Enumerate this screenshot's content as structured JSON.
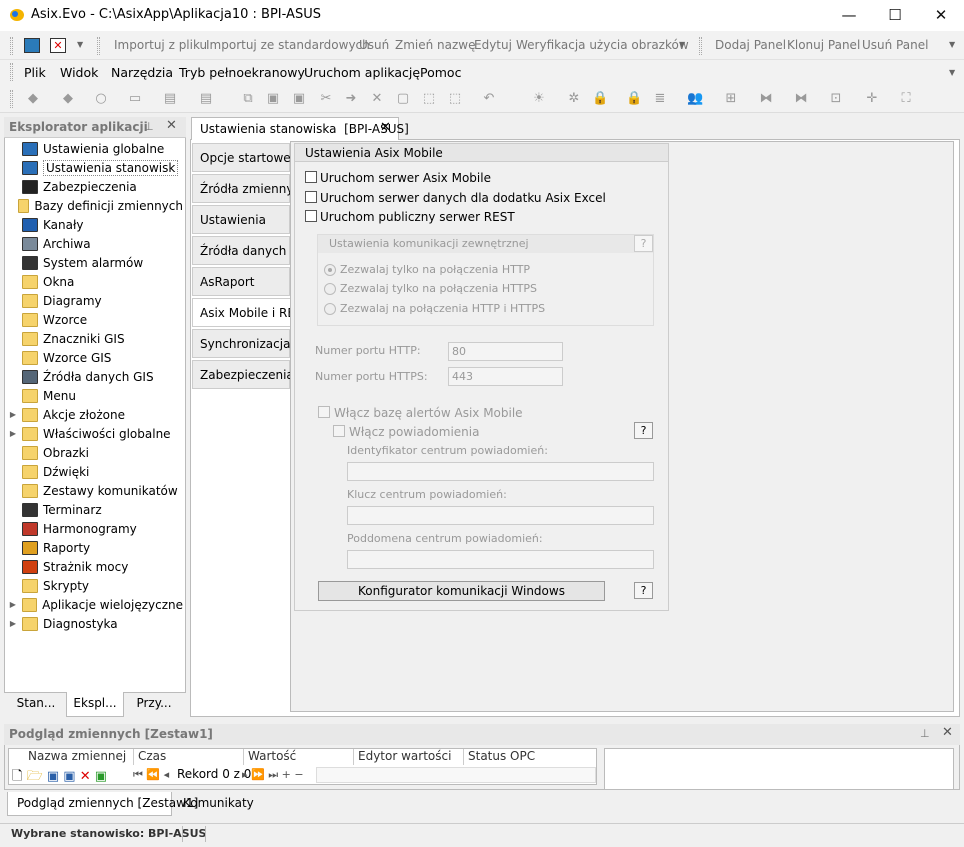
{
  "window": {
    "title": "Asix.Evo - C:\\AsixApp\\Aplikacja10 : BPI-ASUS",
    "min": "—",
    "max": "☐",
    "close": "✕"
  },
  "toolbar1": {
    "import_file": "Importuj z pliku",
    "import_std": "Importuj ze standardowych",
    "delete": "Usuń",
    "rename": "Zmień nazwę",
    "edit": "Edytuj",
    "verify": "Weryfikacja użycia obrazków",
    "add_panel": "Dodaj Panel",
    "clone_panel": "Klonuj Panel",
    "remove_panel": "Usuń Panel"
  },
  "menu": {
    "file": "Plik",
    "view": "Widok",
    "tools": "Narzędzia",
    "fullscreen": "Tryb pełnoekranowy",
    "run": "Uruchom aplikację",
    "help": "Pomoc"
  },
  "explorer": {
    "title": "Eksplorator aplikacji",
    "items": [
      {
        "label": "Ustawienia globalne",
        "icon": "globe-settings-icon",
        "color": "#2a6fb8",
        "expandable": false
      },
      {
        "label": "Ustawienia stanowisk",
        "icon": "workstation-settings-icon",
        "color": "#2a6fb8",
        "expandable": false
      },
      {
        "label": "Zabezpieczenia",
        "icon": "lock-icon",
        "color": "#222222",
        "expandable": false
      },
      {
        "label": "Bazy definicji zmiennych",
        "icon": "folder-icon",
        "color": "",
        "expandable": false
      },
      {
        "label": "Kanały",
        "icon": "globe-icon",
        "color": "#1f5fb0",
        "expandable": false
      },
      {
        "label": "Archiwa",
        "icon": "database-icon",
        "color": "#7a8a9a",
        "expandable": false
      },
      {
        "label": "System alarmów",
        "icon": "alarm-icon",
        "color": "#333333",
        "expandable": false
      },
      {
        "label": "Okna",
        "icon": "folder-icon",
        "color": "",
        "expandable": false
      },
      {
        "label": "Diagramy",
        "icon": "folder-icon",
        "color": "",
        "expandable": false
      },
      {
        "label": "Wzorce",
        "icon": "folder-icon",
        "color": "",
        "expandable": false
      },
      {
        "label": "Znaczniki GIS",
        "icon": "folder-icon",
        "color": "",
        "expandable": false
      },
      {
        "label": "Wzorce GIS",
        "icon": "folder-icon",
        "color": "",
        "expandable": false
      },
      {
        "label": "Źródła danych GIS",
        "icon": "gis-source-icon",
        "color": "#556677",
        "expandable": false
      },
      {
        "label": "Menu",
        "icon": "folder-icon",
        "color": "",
        "expandable": false
      },
      {
        "label": "Akcje złożone",
        "icon": "folder-icon",
        "color": "",
        "expandable": true
      },
      {
        "label": "Właściwości globalne",
        "icon": "folder-icon",
        "color": "",
        "expandable": true
      },
      {
        "label": "Obrazki",
        "icon": "folder-icon",
        "color": "",
        "expandable": false
      },
      {
        "label": "Dźwięki",
        "icon": "folder-icon",
        "color": "",
        "expandable": false
      },
      {
        "label": "Zestawy komunikatów",
        "icon": "folder-icon",
        "color": "",
        "expandable": false
      },
      {
        "label": "Terminarz",
        "icon": "calendar-icon",
        "color": "#333333",
        "expandable": false
      },
      {
        "label": "Harmonogramy",
        "icon": "schedule-icon",
        "color": "#c0392b",
        "expandable": false
      },
      {
        "label": "Raporty",
        "icon": "report-icon",
        "color": "#e0a020",
        "expandable": false
      },
      {
        "label": "Strażnik mocy",
        "icon": "power-guard-icon",
        "color": "#d04010",
        "expandable": false
      },
      {
        "label": "Skrypty",
        "icon": "folder-icon",
        "color": "",
        "expandable": false
      },
      {
        "label": "Aplikacje wielojęzyczne",
        "icon": "folder-icon",
        "color": "",
        "expandable": true
      },
      {
        "label": "Diagnostyka",
        "icon": "folder-icon",
        "color": "",
        "expandable": true
      }
    ],
    "tabs": [
      "Stan...",
      "Ekspl...",
      "Przy..."
    ]
  },
  "document": {
    "tab_title": "Ustawienia stanowiska  [BPI-ASUS]",
    "vtabs": [
      "Opcje startowe",
      "Źródła zmiennych",
      "Ustawienia",
      "Źródła danych",
      "AsRaport",
      "Asix Mobile i REST",
      "Synchronizacja",
      "Zabezpieczenia"
    ],
    "active_vtab": 5
  },
  "mobile": {
    "group_title": "Ustawienia Asix Mobile",
    "cb_mobile_server": "Uruchom serwer Asix Mobile",
    "cb_excel_server": "Uruchom serwer danych dla dodatku Asix Excel",
    "cb_rest": "Uruchom publiczny serwer REST",
    "ext_comm_title": "Ustawienia komunikacji zewnętrznej",
    "radio_http": "Zezwalaj tylko na połączenia HTTP",
    "radio_https": "Zezwalaj tylko na połączenia HTTPS",
    "radio_both": "Zezwalaj na połączenia HTTP i HTTPS",
    "http_port_label": "Numer portu HTTP:",
    "http_port": "80",
    "https_port_label": "Numer portu HTTPS:",
    "https_port": "443",
    "cb_alerts": "Włącz bazę alertów Asix Mobile",
    "cb_notify": "Włącz powiadomienia",
    "hub_id_label": "Identyfikator centrum powiadomień:",
    "hub_key_label": "Klucz centrum powiadomień:",
    "subdomain_label": "Poddomena centrum powiadomień:",
    "configurator_btn": "Konfigurator komunikacji Windows",
    "help": "?"
  },
  "watch": {
    "title": "Podgląd zmiennych [Zestaw1]",
    "columns": [
      "Nazwa zmiennej",
      "Czas",
      "Wartość",
      "Edytor wartości",
      "Status OPC"
    ],
    "record": "Rekord 0 z 0"
  },
  "bottom_tabs": [
    "Podgląd zmiennych [Zestaw1]",
    "Komunikaty"
  ],
  "status": "Wybrane stanowisko: BPI-ASUS"
}
